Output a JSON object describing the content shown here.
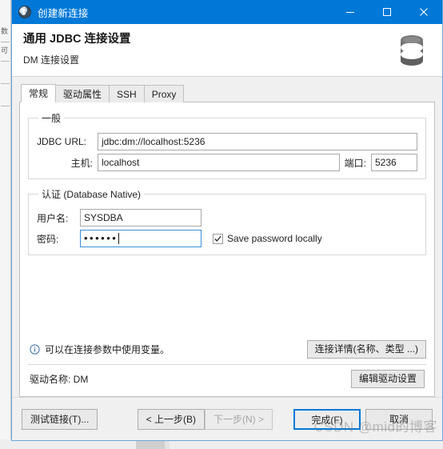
{
  "window": {
    "title": "创建新连接",
    "icon": "dbeaver-app-icon",
    "minimize_label": "最小化",
    "maximize_label": "最大化",
    "close_label": "关闭"
  },
  "header": {
    "title": "通用 JDBC 连接设置",
    "subtitle": "DM 连接设置",
    "icon": "database-icon"
  },
  "tabs": [
    {
      "label": "常规",
      "active": true
    },
    {
      "label": "驱动属性",
      "active": false
    },
    {
      "label": "SSH",
      "active": false
    },
    {
      "label": "Proxy",
      "active": false
    }
  ],
  "general_group": {
    "legend": "一般",
    "jdbc_url_label": "JDBC URL:",
    "jdbc_url_value": "jdbc:dm://localhost:5236",
    "host_label": "主机:",
    "host_value": "localhost",
    "port_label": "端口:",
    "port_value": "5236"
  },
  "auth_group": {
    "legend": "认证 (Database Native)",
    "username_label": "用户名:",
    "username_value": "SYSDBA",
    "password_label": "密码:",
    "password_value": "••••••",
    "save_password_label": "Save password locally",
    "save_password_checked": true
  },
  "hint": {
    "icon": "info-icon",
    "text": "可以在连接参数中使用变量。",
    "details_button": "连接详情(名称、类型 ...)"
  },
  "driver": {
    "text": "驱动名称: DM",
    "edit_button": "编辑驱动设置"
  },
  "footer": {
    "test_button": "测试链接(T)...",
    "back_button": "< 上一步(B)",
    "next_button": "下一步(N) >",
    "next_disabled": true,
    "finish_button": "完成(F)",
    "cancel_button": "取消"
  },
  "watermark": "CSDN @mid的博客",
  "colors": {
    "titlebar": "#0078d7",
    "accent": "#0078d7",
    "focus_border": "#3a8fd6",
    "panel_bg": "#ffffff",
    "dialog_bg": "#f0f0f0"
  }
}
